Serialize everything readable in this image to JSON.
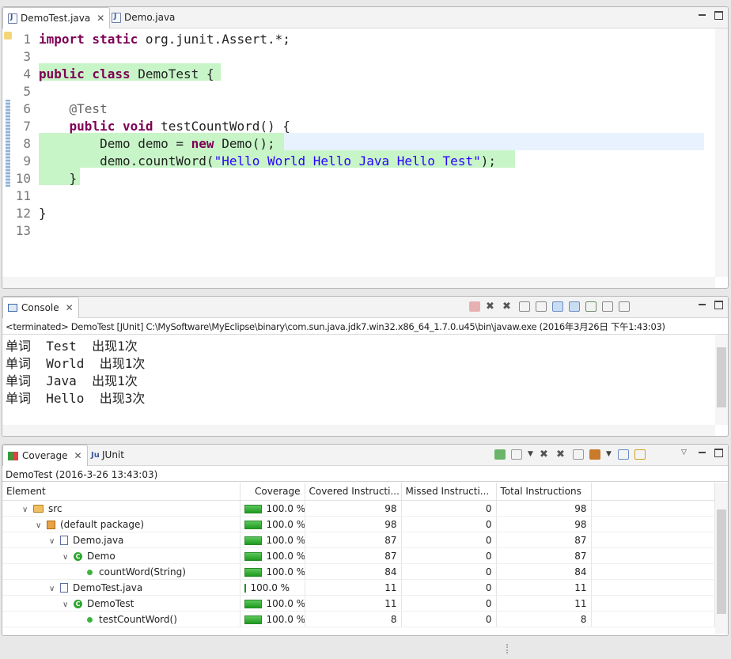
{
  "editor": {
    "tabs": [
      {
        "label": "DemoTest.java",
        "active": true
      },
      {
        "label": "Demo.java",
        "active": false
      }
    ],
    "lines": [
      {
        "num": "1",
        "html_parts": [
          [
            "kw",
            "import static"
          ],
          [
            "",
            " org.junit.Assert.*;"
          ]
        ]
      },
      {
        "num": "3"
      },
      {
        "num": "4",
        "html_parts": [
          [
            "kw",
            "public class"
          ],
          [
            "",
            " DemoTest {"
          ]
        ]
      },
      {
        "num": "5"
      },
      {
        "num": "6",
        "html_parts": [
          [
            "",
            "    "
          ],
          [
            "ann",
            "@Test"
          ]
        ]
      },
      {
        "num": "7",
        "html_parts": [
          [
            "",
            "    "
          ],
          [
            "kw",
            "public void"
          ],
          [
            "",
            " testCountWord() {"
          ]
        ]
      },
      {
        "num": "8",
        "html_parts": [
          [
            "",
            "        Demo demo = "
          ],
          [
            "kw",
            "new"
          ],
          [
            "",
            " Demo();"
          ]
        ]
      },
      {
        "num": "9",
        "html_parts": [
          [
            "",
            "        demo.countWord("
          ],
          [
            "str",
            "\"Hello World Hello Java Hello Test\""
          ],
          [
            "",
            ");"
          ]
        ]
      },
      {
        "num": "10",
        "html_parts": [
          [
            "",
            "    }"
          ]
        ]
      },
      {
        "num": "11"
      },
      {
        "num": "12",
        "html_parts": [
          [
            "",
            "}"
          ]
        ]
      },
      {
        "num": "13"
      }
    ]
  },
  "console": {
    "tab_label": "Console",
    "status": "<terminated> DemoTest [JUnit] C:\\MySoftware\\MyEclipse\\binary\\com.sun.java.jdk7.win32.x86_64_1.7.0.u45\\bin\\javaw.exe (2016年3月26日 下午1:43:03)",
    "output": [
      "单词  Test  出现1次",
      "单词  World  出现1次",
      "单词  Java  出现1次",
      "单词  Hello  出现3次"
    ]
  },
  "coverage": {
    "tabs": [
      {
        "label": "Coverage",
        "active": true
      },
      {
        "label": "JUnit",
        "active": false
      }
    ],
    "session": "DemoTest (2016-3-26 13:43:03)",
    "columns": [
      "Element",
      "Coverage",
      "Covered Instructi...",
      "Missed Instructi...",
      "Total Instructions"
    ],
    "rows": [
      {
        "indent": 1,
        "icon": "source-folder-icon",
        "name": "src",
        "coverage": "100.0 %",
        "covered": "98",
        "missed": "0",
        "total": "98"
      },
      {
        "indent": 2,
        "icon": "package-icon",
        "name": "(default package)",
        "coverage": "100.0 %",
        "covered": "98",
        "missed": "0",
        "total": "98"
      },
      {
        "indent": 3,
        "icon": "java-file-icon",
        "name": "Demo.java",
        "coverage": "100.0 %",
        "covered": "87",
        "missed": "0",
        "total": "87"
      },
      {
        "indent": 4,
        "icon": "class-icon",
        "name": "Demo",
        "coverage": "100.0 %",
        "covered": "87",
        "missed": "0",
        "total": "87"
      },
      {
        "indent": 5,
        "icon": "method-icon",
        "name": "countWord(String)",
        "coverage": "100.0 %",
        "covered": "84",
        "missed": "0",
        "total": "84"
      },
      {
        "indent": 3,
        "icon": "java-file-icon",
        "name": "DemoTest.java",
        "coverage": "100.0 %",
        "covered": "11",
        "missed": "0",
        "total": "11"
      },
      {
        "indent": 4,
        "icon": "class-icon",
        "name": "DemoTest",
        "coverage": "100.0 %",
        "covered": "11",
        "missed": "0",
        "total": "11"
      },
      {
        "indent": 5,
        "icon": "method-icon",
        "name": "testCountWord()",
        "coverage": "100.0 %",
        "covered": "8",
        "missed": "0",
        "total": "8"
      }
    ]
  }
}
